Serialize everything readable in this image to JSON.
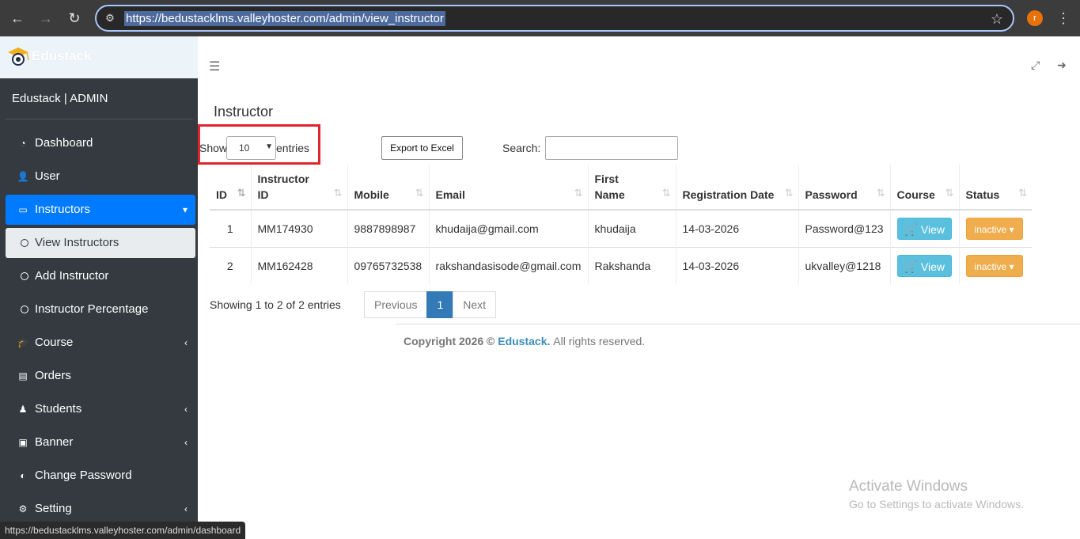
{
  "browser": {
    "url": "https://bedustacklms.valleyhoster.com/admin/view_instructor",
    "profile_initial": "r",
    "status_url": "https://bedustacklms.valleyhoster.com/admin/dashboard"
  },
  "brand": {
    "name": "Edustack"
  },
  "sidebar": {
    "user_title": "Edustack | ADMIN",
    "items": [
      {
        "label": "Dashboard",
        "icon": "gauge-icon"
      },
      {
        "label": "User",
        "icon": "user-icon"
      },
      {
        "label": "Instructors",
        "icon": "instructor-icon"
      },
      {
        "label": "View Instructors",
        "icon": "circle-icon"
      },
      {
        "label": "Add Instructor",
        "icon": "circle-icon"
      },
      {
        "label": "Instructor Percentage",
        "icon": "circle-icon"
      },
      {
        "label": "Course",
        "icon": "course-icon"
      },
      {
        "label": "Orders",
        "icon": "orders-icon"
      },
      {
        "label": "Students",
        "icon": "students-icon"
      },
      {
        "label": "Banner",
        "icon": "banner-icon"
      },
      {
        "label": "Change Password",
        "icon": "toggle-icon"
      },
      {
        "label": "Setting",
        "icon": "settings-icon"
      }
    ]
  },
  "main": {
    "title": "Instructor",
    "show_label": "Show",
    "entries_value": "10",
    "entries_label": "entries",
    "export_label": "Export to Excel",
    "search_label": "Search:",
    "search_value": "",
    "table": {
      "headers": [
        "ID",
        "Instructor ID",
        "Mobile",
        "Email",
        "First Name",
        "Registration Date",
        "Password",
        "Course",
        "Status"
      ],
      "rows": [
        {
          "id": "1",
          "instructor_id": "MM174930",
          "mobile": "9887898987",
          "email": "khudaija@gmail.com",
          "first_name": "khudaija",
          "reg_date": "14-03-2026",
          "password": "Password@123",
          "course": "View",
          "status": "inactive"
        },
        {
          "id": "2",
          "instructor_id": "MM162428",
          "mobile": "09765732538",
          "email": "rakshandasisode@gmail.com",
          "first_name": "Rakshanda",
          "reg_date": "14-03-2026",
          "password": "ukvalley@1218",
          "course": "View",
          "status": "inactive"
        }
      ]
    },
    "info": "Showing 1 to 2 of 2 entries",
    "pager": {
      "previous": "Previous",
      "current": "1",
      "next": "Next"
    }
  },
  "footer": {
    "copyright_prefix": "Copyright 2026 ©",
    "brand": "Edustack.",
    "rights": "All rights reserved."
  },
  "watermark": {
    "line1": "Activate Windows",
    "line2": "Go to Settings to activate Windows."
  },
  "colors": {
    "primary": "#007bff",
    "sidebar": "#343a40",
    "info_button": "#5bc0de",
    "warning_button": "#f0ad4e"
  }
}
